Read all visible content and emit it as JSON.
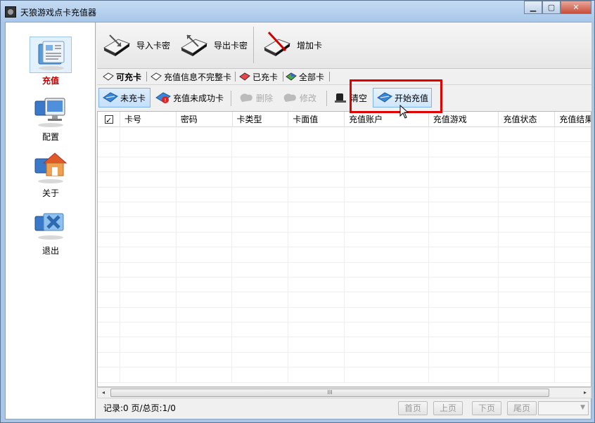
{
  "window": {
    "title": "天狼游戏点卡充值器",
    "minimize": "0",
    "maximize": "1",
    "close": "r"
  },
  "sidebar": {
    "items": [
      {
        "label": "充值",
        "icon": "newspaper-icon",
        "active": true
      },
      {
        "label": "配置",
        "icon": "monitor-icon",
        "active": false
      },
      {
        "label": "关于",
        "icon": "house-icon",
        "active": false
      },
      {
        "label": "退出",
        "icon": "exit-icon",
        "active": false
      }
    ]
  },
  "toolbar": {
    "import_label": "导入卡密",
    "export_label": "导出卡密",
    "add_label": "增加卡"
  },
  "tabs": [
    {
      "label": "可充卡",
      "active": true
    },
    {
      "label": "充值信息不完整卡",
      "active": false
    },
    {
      "label": "已充卡",
      "active": false
    },
    {
      "label": "全部卡",
      "active": false
    }
  ],
  "actions": {
    "uncharged_label": "未充卡",
    "failed_label": "充值未成功卡",
    "delete_label": "删除",
    "edit_label": "修改",
    "clear_label": "清空",
    "start_label": "开始充值"
  },
  "grid": {
    "columns": [
      "卡号",
      "密码",
      "卡类型",
      "卡面值",
      "充值账户",
      "充值游戏",
      "充值状态",
      "充值结果"
    ],
    "rows": []
  },
  "scrollbar": {
    "left": "◂",
    "right": "▸",
    "grip": "III"
  },
  "status": {
    "text": "记录:0 页/总页:1/0"
  },
  "pager": {
    "first": "首页",
    "prev": "上页",
    "next": "下页",
    "last": "尾页",
    "select_value": ""
  },
  "colors": {
    "highlight": "#e00000",
    "active_label": "#c00000",
    "title_bar": "#a8c7ea"
  }
}
